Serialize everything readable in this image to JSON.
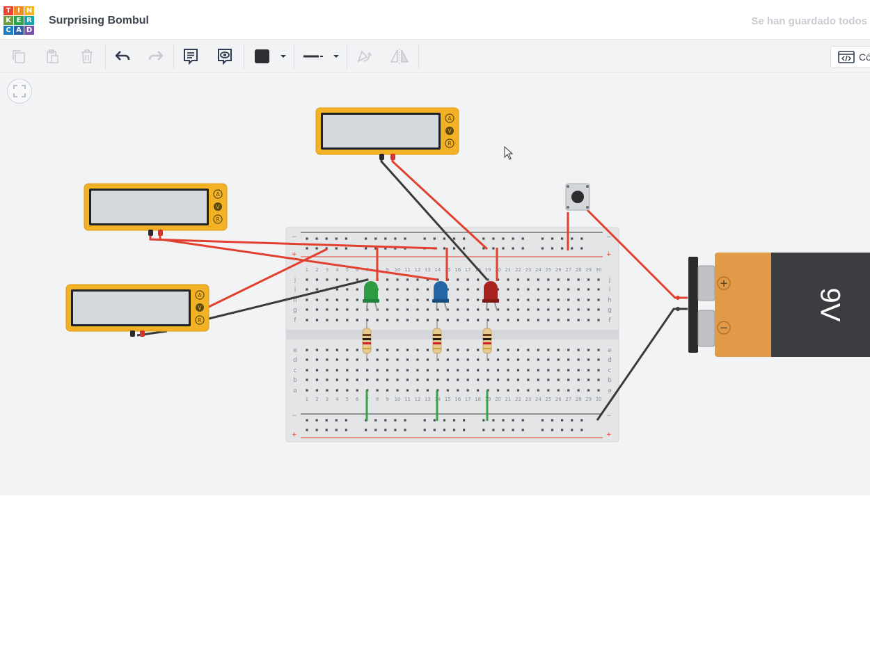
{
  "app": {
    "logo_letters": [
      "T",
      "I",
      "N",
      "K",
      "E",
      "R",
      "C",
      "A",
      "D"
    ],
    "logo_colors": [
      "#e8442e",
      "#f28c28",
      "#f6b324",
      "#6a9e3f",
      "#2ba24c",
      "#18a3a9",
      "#1b7fc1",
      "#2f5fa8",
      "#7a54a8"
    ],
    "project_title": "Surprising Bombul",
    "save_status": "Se han guardado todos"
  },
  "toolbar": {
    "tools": [
      {
        "name": "copy-icon",
        "enabled": false
      },
      {
        "name": "paste-icon",
        "enabled": false
      },
      {
        "name": "delete-icon",
        "enabled": false
      },
      {
        "name": "undo-icon",
        "enabled": true
      },
      {
        "name": "redo-icon",
        "enabled": false
      },
      {
        "name": "notes-icon",
        "enabled": true
      },
      {
        "name": "eye-icon",
        "enabled": true
      },
      {
        "name": "color-picker-icon",
        "enabled": true
      },
      {
        "name": "wire-type-icon",
        "enabled": true
      },
      {
        "name": "rotate-icon",
        "enabled": false
      },
      {
        "name": "flip-icon",
        "enabled": false
      }
    ],
    "code_label": "Có"
  },
  "circuit": {
    "multimeters": [
      {
        "id": "multimeter-1",
        "buttons": [
          "A",
          "V",
          "R"
        ],
        "active": "V"
      },
      {
        "id": "multimeter-2",
        "buttons": [
          "A",
          "V",
          "R"
        ],
        "active": "V"
      },
      {
        "id": "multimeter-3",
        "buttons": [
          "A",
          "V",
          "R"
        ],
        "active": "V"
      }
    ],
    "breadboard": {
      "columns": 30,
      "rows_top": [
        "j",
        "i",
        "h",
        "g",
        "f"
      ],
      "rows_bottom": [
        "e",
        "d",
        "c",
        "b",
        "a"
      ],
      "rail_minus": "−",
      "rail_plus": "+"
    },
    "leds": [
      {
        "color_name": "green",
        "color": "#2e9b45"
      },
      {
        "color_name": "blue",
        "color": "#2466a3"
      },
      {
        "color_name": "red",
        "color": "#a8231f"
      }
    ],
    "battery": {
      "label": "9V",
      "terminal_plus": "+",
      "terminal_minus": "−"
    },
    "wire_colors": {
      "red": "#e2402e",
      "black": "#3a3a3a",
      "green": "#3aa34a"
    }
  }
}
